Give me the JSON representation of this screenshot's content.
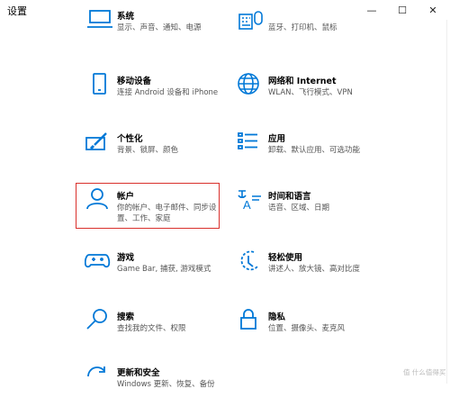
{
  "window": {
    "title": "设置",
    "minimize_glyph": "—",
    "maximize_glyph": "☐",
    "close_glyph": "✕"
  },
  "accent_color": "#0078d7",
  "tiles": [
    {
      "id": "system",
      "title": "系统",
      "subtitle": "显示、声音、通知、电源",
      "icon": "laptop-icon"
    },
    {
      "id": "devices",
      "title": "",
      "subtitle": "蓝牙、打印机、鼠标",
      "icon": "keyboard-devices-icon"
    },
    {
      "id": "phone",
      "title": "移动设备",
      "subtitle": "连接 Android 设备和 iPhone",
      "icon": "phone-icon"
    },
    {
      "id": "network",
      "title": "网络和 Internet",
      "subtitle": "WLAN、飞行模式、VPN",
      "icon": "globe-icon"
    },
    {
      "id": "personalization",
      "title": "个性化",
      "subtitle": "背景、锁屏、颜色",
      "icon": "paintbrush-icon"
    },
    {
      "id": "apps",
      "title": "应用",
      "subtitle": "卸载、默认应用、可选功能",
      "icon": "apps-list-icon"
    },
    {
      "id": "accounts",
      "title": "帐户",
      "subtitle": "你的帐户、电子邮件、同步设置、工作、家庭",
      "icon": "person-icon"
    },
    {
      "id": "time",
      "title": "时间和语言",
      "subtitle": "语音、区域、日期",
      "icon": "time-language-icon"
    },
    {
      "id": "gaming",
      "title": "游戏",
      "subtitle": "Game Bar, 捕获, 游戏模式",
      "icon": "gamepad-icon"
    },
    {
      "id": "ease",
      "title": "轻松使用",
      "subtitle": "讲述人、放大镜、高对比度",
      "icon": "ease-of-access-icon"
    },
    {
      "id": "search",
      "title": "搜索",
      "subtitle": "查找我的文件、权限",
      "icon": "search-icon"
    },
    {
      "id": "privacy",
      "title": "隐私",
      "subtitle": "位置、摄像头、麦克风",
      "icon": "lock-icon"
    },
    {
      "id": "update",
      "title": "更新和安全",
      "subtitle": "Windows 更新、恢复、备份",
      "icon": "sync-icon"
    }
  ],
  "watermark": "值 什么值得买"
}
